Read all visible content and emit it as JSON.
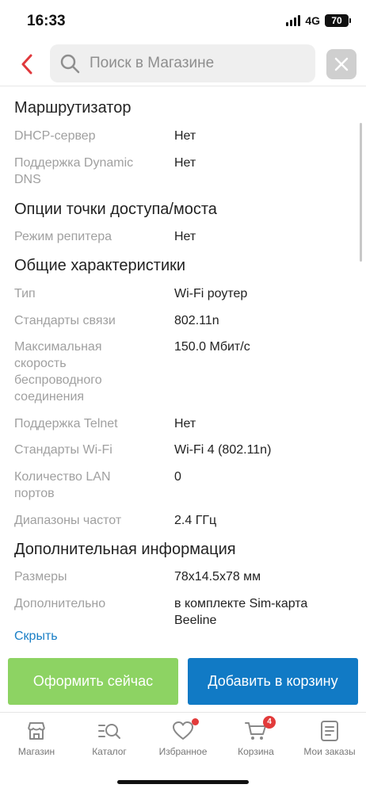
{
  "status": {
    "time": "16:33",
    "network": "4G",
    "battery": "70"
  },
  "search": {
    "placeholder": "Поиск в Магазине"
  },
  "sections": [
    {
      "title": "Маршрутизатор"
    },
    {
      "title": "Опции точки доступа/моста"
    },
    {
      "title": "Общие характеристики"
    },
    {
      "title": "Дополнительная информация"
    }
  ],
  "rows": [
    {
      "label": "DHCP-сервер",
      "value": "Нет"
    },
    {
      "label": "Поддержка Dynamic DNS",
      "value": "Нет"
    },
    {
      "label": "Режим репитера",
      "value": "Нет"
    },
    {
      "label": "Тип",
      "value": "Wi-Fi роутер"
    },
    {
      "label": "Стандарты связи",
      "value": "802.11n"
    },
    {
      "label": "Максимальная скорость беспроводного соединения",
      "value": "150.0 Мбит/с"
    },
    {
      "label": "Поддержка Telnet",
      "value": "Нет"
    },
    {
      "label": "Стандарты Wi-Fi",
      "value": "Wi-Fi 4 (802.11n)"
    },
    {
      "label": "Количество LAN портов",
      "value": "0"
    },
    {
      "label": "Диапазоны частот",
      "value": "2.4 ГГц"
    },
    {
      "label": "Размеры",
      "value": "78x14.5x78 мм"
    },
    {
      "label": "Дополнительно",
      "value": "в комплекте Sim-карта Beeline"
    }
  ],
  "hide_link": "Скрыть",
  "actions": {
    "checkout": "Оформить сейчас",
    "add_to_cart": "Добавить в корзину"
  },
  "tabs": [
    {
      "label": "Магазин",
      "icon": "store-icon"
    },
    {
      "label": "Каталог",
      "icon": "catalog-search-icon"
    },
    {
      "label": "Избранное",
      "icon": "heart-icon"
    },
    {
      "label": "Корзина",
      "icon": "cart-icon",
      "badge": "4"
    },
    {
      "label": "Мои заказы",
      "icon": "orders-icon"
    }
  ],
  "colors": {
    "accent_blue": "#117ac5",
    "accent_green": "#8dd363",
    "back_red": "#e0383c",
    "badge_red": "#e23b3b"
  }
}
